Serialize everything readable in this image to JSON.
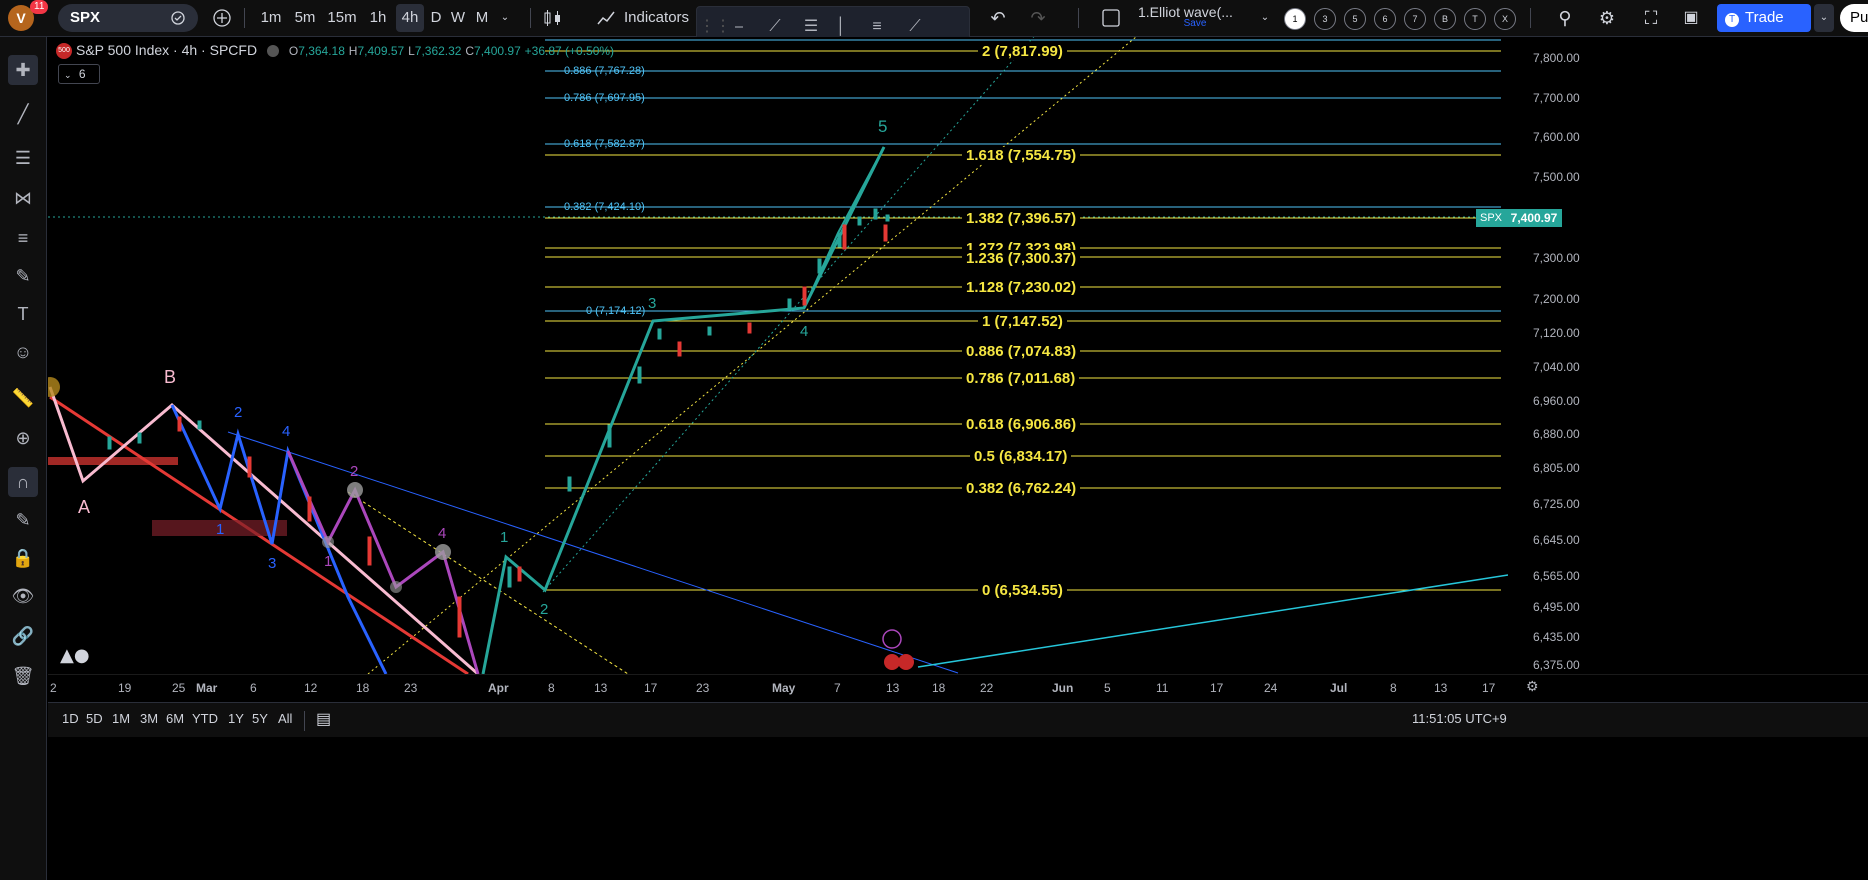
{
  "header": {
    "notification_count": "11",
    "avatar_letter": "V",
    "symbol": "SPX",
    "timeframes": [
      "1m",
      "5m",
      "15m",
      "1h",
      "4h",
      "D",
      "W",
      "M"
    ],
    "active_timeframe": "4h",
    "indicators_label": "Indicators",
    "layout_name": "1.Elliot wave(...",
    "layout_status": "Save",
    "wave_counts": [
      "1",
      "3",
      "5",
      "6",
      "7",
      "B",
      "T",
      "X"
    ],
    "trade_label": "Trade",
    "publish_label": "Pu"
  },
  "legend": {
    "title": "S&P 500 Index · 4h · SPCFD",
    "badge": "500",
    "o_label": "O",
    "o": "7,364.18",
    "h_label": "H",
    "h": "7,409.57",
    "l_label": "L",
    "l": "7,362.32",
    "c_label": "C",
    "c": "7,400.97",
    "change": "+36.87 (+0.50%)",
    "indicator_count": "6"
  },
  "price_axis": [
    "7,800.00",
    "7,700.00",
    "7,600.00",
    "7,500.00",
    "7,300.00",
    "7,200.00",
    "7,120.00",
    "7,040.00",
    "6,960.00",
    "6,880.00",
    "6,805.00",
    "6,725.00",
    "6,645.00",
    "6,565.00",
    "6,495.00",
    "6,435.00",
    "6,375.00"
  ],
  "last_price": "7,400.97",
  "last_symbol": "SPX",
  "time_axis": [
    "2",
    "19",
    "25",
    "Mar",
    "6",
    "12",
    "18",
    "23",
    "Apr",
    "8",
    "13",
    "17",
    "23",
    "May",
    "7",
    "13",
    "18",
    "22",
    "Jun",
    "5",
    "11",
    "17",
    "24",
    "Jul",
    "8",
    "13",
    "17"
  ],
  "fib_extension": [
    {
      "label": "2 (7,817.99)"
    },
    {
      "label": "1.618 (7,554.75)"
    },
    {
      "label": "1.382 (7,396.57)"
    },
    {
      "label": "1.272 (7,323.98)"
    },
    {
      "label": "1.236 (7,300.37)"
    },
    {
      "label": "1.128 (7,230.02)"
    },
    {
      "label": "1 (7,147.52)"
    },
    {
      "label": "0.886 (7,074.83)"
    },
    {
      "label": "0.786 (7,011.68)"
    },
    {
      "label": "0.618 (6,906.86)"
    },
    {
      "label": "0.5 (6,834.17)"
    },
    {
      "label": "0.382 (6,762.24)"
    },
    {
      "label": "0 (6,534.55)"
    }
  ],
  "fib_retracement": [
    {
      "label": "0.886 (7,767.28)"
    },
    {
      "label": "0.786 (7,697.95)"
    },
    {
      "label": "0.618 (7,582.87)"
    },
    {
      "label": "0.382 (7,424.10)"
    },
    {
      "label": "0 (7,174.12)"
    }
  ],
  "wave_labels": {
    "A": "A",
    "B": "B",
    "w1": "1",
    "w2": "2",
    "w3": "3",
    "w4": "4",
    "w5": "5"
  },
  "bottom": {
    "ranges": [
      "1D",
      "5D",
      "1M",
      "3M",
      "6M",
      "YTD",
      "1Y",
      "5Y",
      "All"
    ],
    "clock": "11:51:05 UTC+9"
  },
  "colors": {
    "fib_yellow": "#f5e642",
    "fib_blue": "#4fc3f7",
    "wave_green": "#26a69a",
    "wave_pink": "#f8bbd0",
    "wave_blue": "#2962ff",
    "wave_purple": "#ab47bc",
    "channel_red": "#e53935"
  }
}
